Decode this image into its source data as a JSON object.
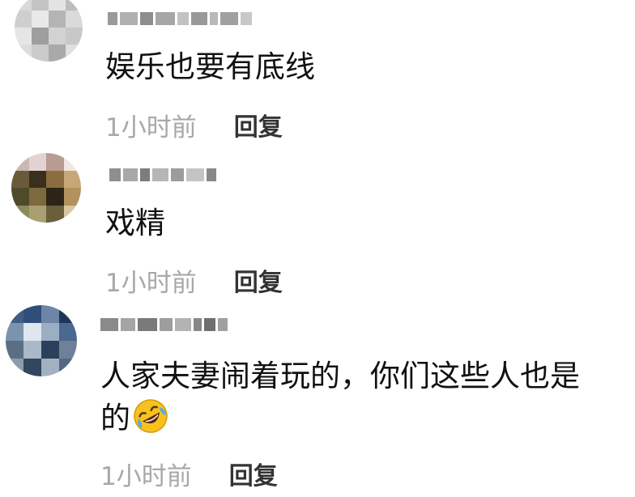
{
  "comments": [
    {
      "username": "",
      "text": "娱乐也要有底线",
      "time": "1小时前",
      "reply_label": "回复"
    },
    {
      "username": "",
      "text": "戏精",
      "time": "1小时前",
      "reply_label": "回复"
    },
    {
      "username": "",
      "text_line1": "人家夫妻闹着玩的，你们这些人也是",
      "text_line2": "的",
      "emoji": "rolling-on-floor-laughing-icon",
      "time": "1小时前",
      "reply_label": "回复"
    }
  ],
  "colors": {
    "text": "#111111",
    "time": "#a8a8a8",
    "reply": "#333333",
    "emoji_face": "#f7c21e"
  }
}
